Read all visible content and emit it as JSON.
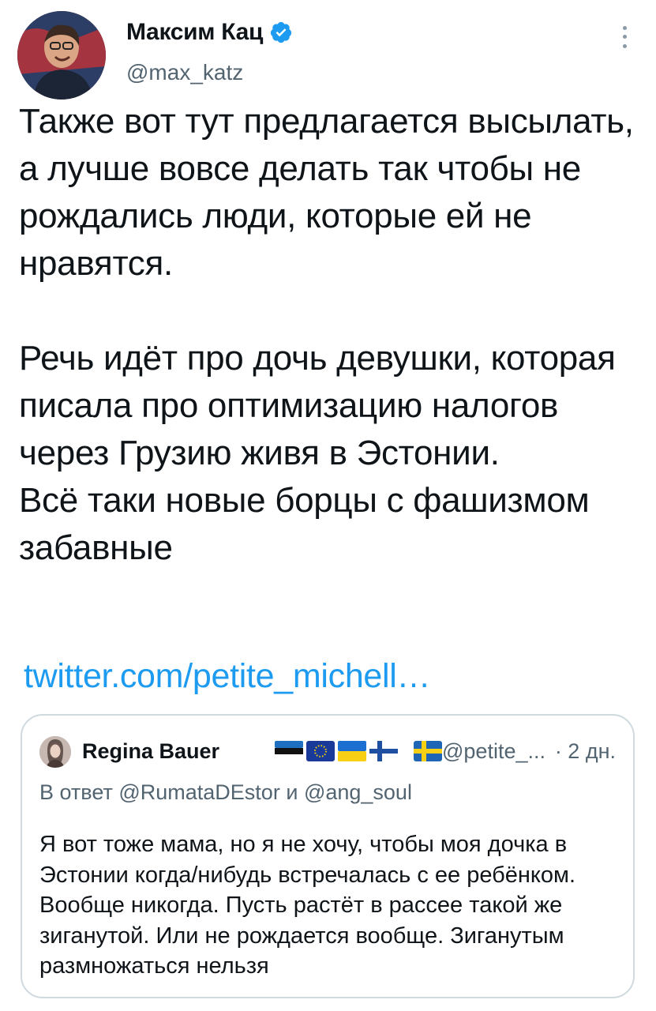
{
  "author": {
    "display_name": "Максим Кац",
    "handle": "@max_katz",
    "verified_icon": "verified-badge-icon",
    "avatar_icon": "user-avatar"
  },
  "tweet": {
    "paragraph1": "Также вот тут предлагается высылать, а лучше вовсе делать так чтобы не рождались люди, которые ей не нравятся.",
    "paragraph2": "Речь идёт про дочь девушки, которая писала про оптимизацию налогов через Грузию живя в Эстонии.",
    "paragraph3": "Всё таки новые борцы с фашизмом забавные",
    "link": "twitter.com/petite_michell…"
  },
  "quote": {
    "display_name": "Regina Bauer",
    "flags": [
      "estonia-flag-icon",
      "eu-flag-icon",
      "ukraine-flag-icon",
      "finland-flag-icon",
      "sweden-flag-icon"
    ],
    "handle": "@petite_...",
    "time": "· 2 дн.",
    "reply_prefix": "В ответ",
    "reply_user1": "@RumataDEstor",
    "reply_and": "и",
    "reply_user2": "@ang_soul",
    "text": "Я вот тоже мама, но я не хочу, чтобы моя дочка в Эстонии когда/нибудь встречалась с ее ребёнком. Вообще никогда. Пусть растёт в рассее такой же зиганутой. Или не рождается вообще. Зиганутым размножаться нельзя"
  },
  "colors": {
    "link": "#1d9bf0",
    "verified": "#1d9bf0",
    "secondary_text": "#536471",
    "border": "#cfd9de"
  }
}
